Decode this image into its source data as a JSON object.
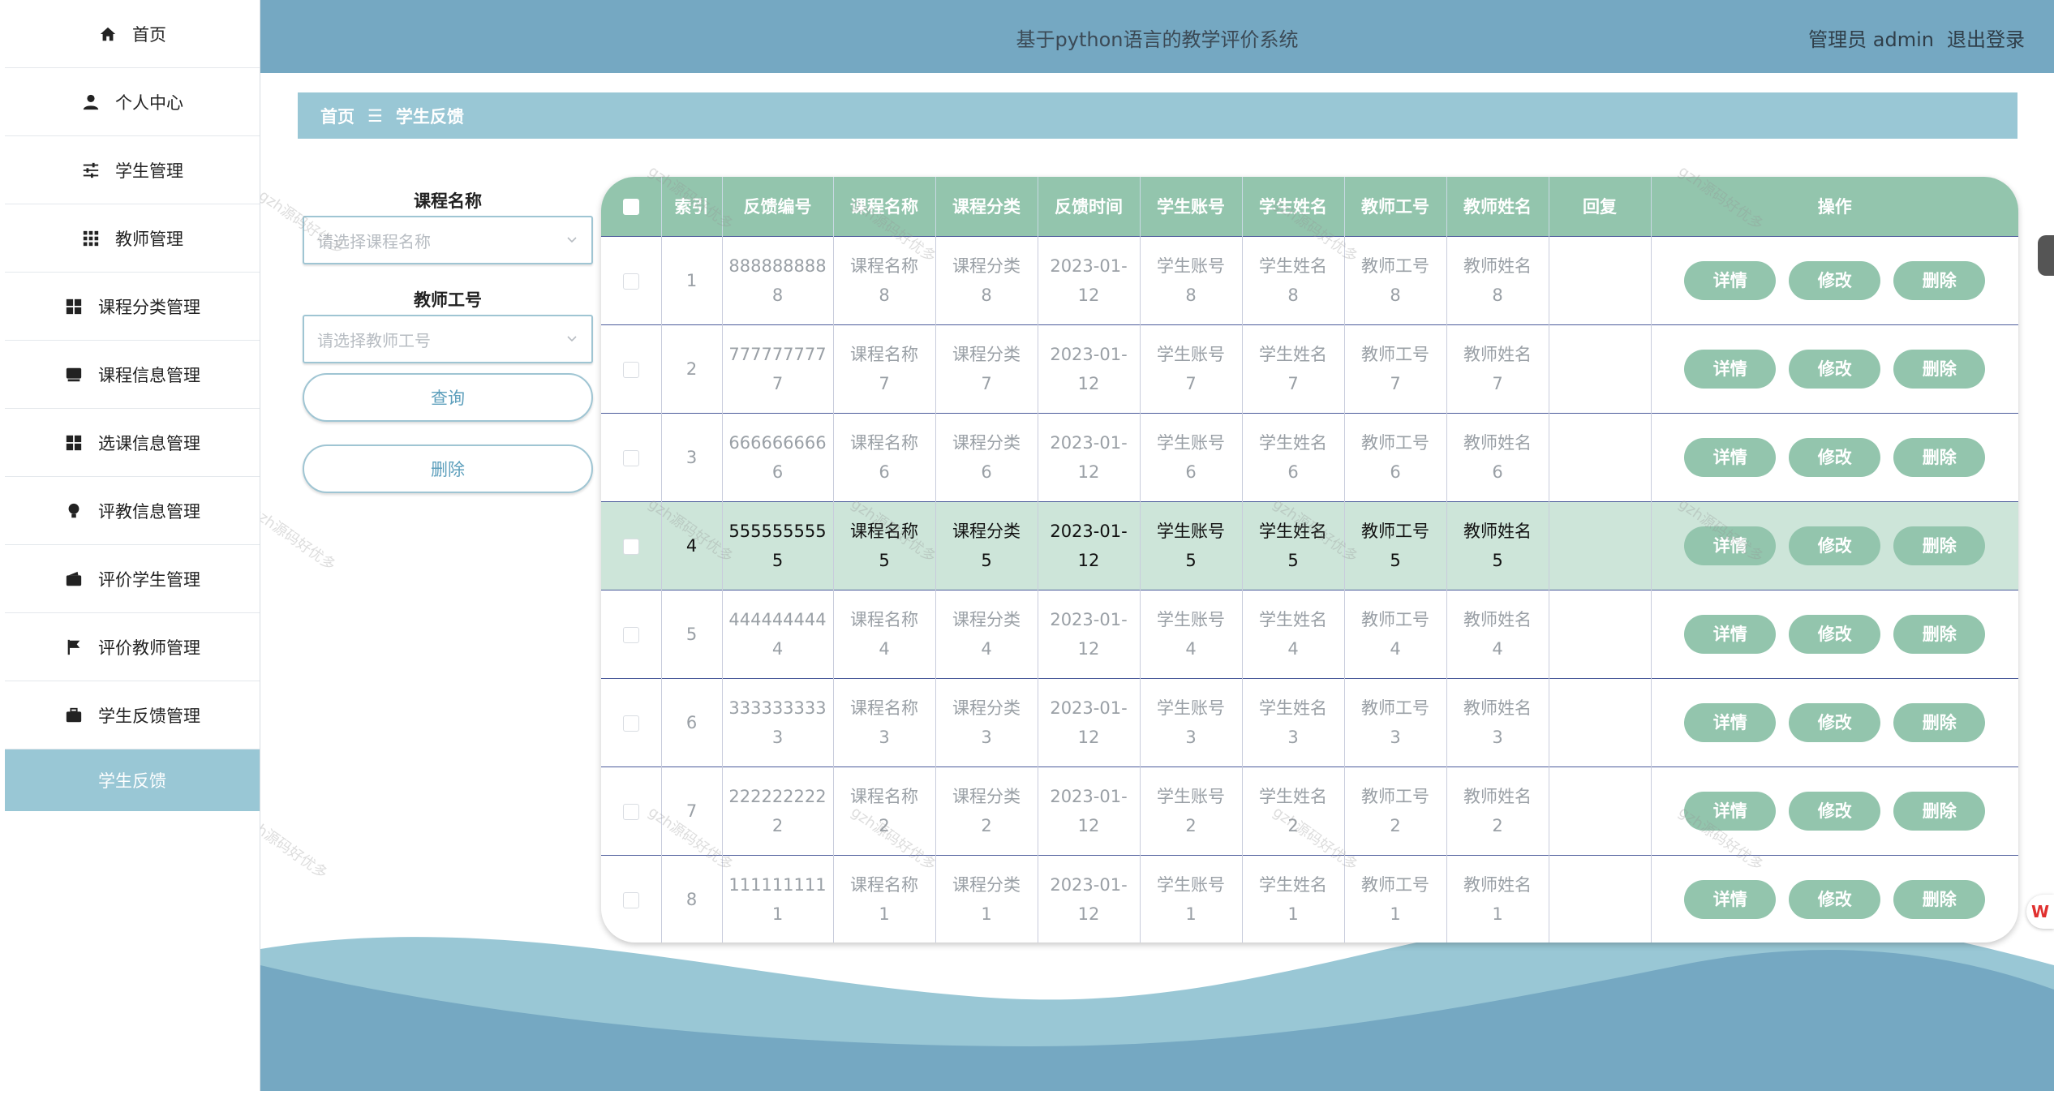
{
  "sidebar": {
    "items": [
      {
        "label": "首页",
        "icon": "home-icon"
      },
      {
        "label": "个人中心",
        "icon": "user-icon"
      },
      {
        "label": "学生管理",
        "icon": "sliders-icon"
      },
      {
        "label": "教师管理",
        "icon": "grid-icon"
      },
      {
        "label": "课程分类管理",
        "icon": "dashboard-icon"
      },
      {
        "label": "课程信息管理",
        "icon": "inbox-icon"
      },
      {
        "label": "选课信息管理",
        "icon": "dashboard-icon"
      },
      {
        "label": "评教信息管理",
        "icon": "bulb-icon"
      },
      {
        "label": "评价学生管理",
        "icon": "wallet-icon"
      },
      {
        "label": "评价教师管理",
        "icon": "flag-icon"
      },
      {
        "label": "学生反馈管理",
        "icon": "briefcase-icon"
      }
    ],
    "active_item": "学生反馈"
  },
  "header": {
    "title": "基于python语言的教学评价系统",
    "user": "管理员 admin",
    "logout": "退出登录"
  },
  "breadcrumb": {
    "home": "首页",
    "sep": "☰",
    "current": "学生反馈"
  },
  "search": {
    "course_label": "课程名称",
    "course_placeholder": "请选择课程名称",
    "teacher_label": "教师工号",
    "teacher_placeholder": "请选择教师工号",
    "query_button": "查询",
    "delete_button": "删除"
  },
  "table": {
    "columns": [
      "索引",
      "反馈编号",
      "课程名称",
      "课程分类",
      "反馈时间",
      "学生账号",
      "学生姓名",
      "教师工号",
      "教师姓名",
      "回复",
      "操作"
    ],
    "ops": {
      "detail": "详情",
      "edit": "修改",
      "delete": "删除"
    },
    "rows": [
      {
        "idx": "1",
        "no1": "888888888",
        "no2": "8",
        "c1": "课程名称",
        "c2": "8",
        "t1": "课程分类",
        "t2": "8",
        "d1": "2023-01-",
        "d2": "12",
        "a1": "学生账号",
        "a2": "8",
        "n1": "学生姓名",
        "n2": "8",
        "g1": "教师工号",
        "g2": "8",
        "m1": "教师姓名",
        "m2": "8",
        "reply": ""
      },
      {
        "idx": "2",
        "no1": "777777777",
        "no2": "7",
        "c1": "课程名称",
        "c2": "7",
        "t1": "课程分类",
        "t2": "7",
        "d1": "2023-01-",
        "d2": "12",
        "a1": "学生账号",
        "a2": "7",
        "n1": "学生姓名",
        "n2": "7",
        "g1": "教师工号",
        "g2": "7",
        "m1": "教师姓名",
        "m2": "7",
        "reply": ""
      },
      {
        "idx": "3",
        "no1": "666666666",
        "no2": "6",
        "c1": "课程名称",
        "c2": "6",
        "t1": "课程分类",
        "t2": "6",
        "d1": "2023-01-",
        "d2": "12",
        "a1": "学生账号",
        "a2": "6",
        "n1": "学生姓名",
        "n2": "6",
        "g1": "教师工号",
        "g2": "6",
        "m1": "教师姓名",
        "m2": "6",
        "reply": ""
      },
      {
        "idx": "4",
        "no1": "555555555",
        "no2": "5",
        "c1": "课程名称",
        "c2": "5",
        "t1": "课程分类",
        "t2": "5",
        "d1": "2023-01-",
        "d2": "12",
        "a1": "学生账号",
        "a2": "5",
        "n1": "学生姓名",
        "n2": "5",
        "g1": "教师工号",
        "g2": "5",
        "m1": "教师姓名",
        "m2": "5",
        "reply": ""
      },
      {
        "idx": "5",
        "no1": "444444444",
        "no2": "4",
        "c1": "课程名称",
        "c2": "4",
        "t1": "课程分类",
        "t2": "4",
        "d1": "2023-01-",
        "d2": "12",
        "a1": "学生账号",
        "a2": "4",
        "n1": "学生姓名",
        "n2": "4",
        "g1": "教师工号",
        "g2": "4",
        "m1": "教师姓名",
        "m2": "4",
        "reply": ""
      },
      {
        "idx": "6",
        "no1": "333333333",
        "no2": "3",
        "c1": "课程名称",
        "c2": "3",
        "t1": "课程分类",
        "t2": "3",
        "d1": "2023-01-",
        "d2": "12",
        "a1": "学生账号",
        "a2": "3",
        "n1": "学生姓名",
        "n2": "3",
        "g1": "教师工号",
        "g2": "3",
        "m1": "教师姓名",
        "m2": "3",
        "reply": ""
      },
      {
        "idx": "7",
        "no1": "222222222",
        "no2": "2",
        "c1": "课程名称",
        "c2": "2",
        "t1": "课程分类",
        "t2": "2",
        "d1": "2023-01-",
        "d2": "12",
        "a1": "学生账号",
        "a2": "2",
        "n1": "学生姓名",
        "n2": "2",
        "g1": "教师工号",
        "g2": "2",
        "m1": "教师姓名",
        "m2": "2",
        "reply": ""
      },
      {
        "idx": "8",
        "no1": "111111111",
        "no2": "1",
        "c1": "课程名称",
        "c2": "1",
        "t1": "课程分类",
        "t2": "1",
        "d1": "2023-01-",
        "d2": "12",
        "a1": "学生账号",
        "a2": "1",
        "n1": "学生姓名",
        "n2": "1",
        "g1": "教师工号",
        "g2": "1",
        "m1": "教师姓名",
        "m2": "1",
        "reply": ""
      }
    ]
  },
  "watermark": "gzh源码好优多",
  "wps_badge": "W",
  "colors": {
    "topbar": "#75a8c2",
    "accent": "#99c7d5",
    "table_header": "#93c5ad",
    "highlight_row": "#cde5d9"
  }
}
